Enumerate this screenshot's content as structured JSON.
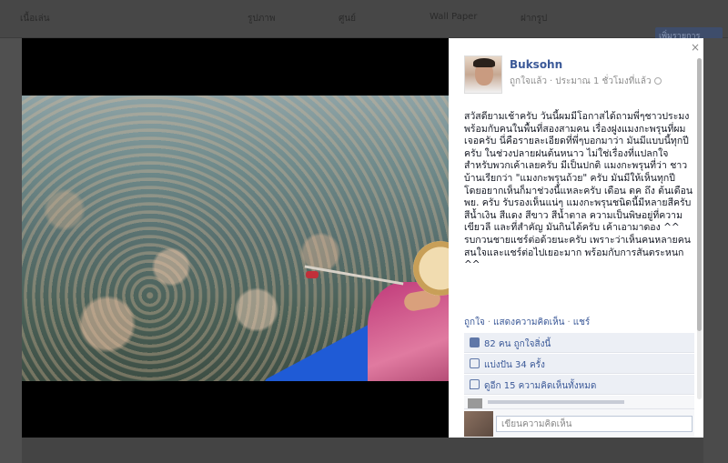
{
  "background": {
    "nav_items": [
      "เนื้อเล่น",
      "รูปภาพ",
      "ศูนย์",
      "Wall Paper",
      "ฝากรูป"
    ],
    "side_button": "เพิ่มรายการ"
  },
  "viewer": {
    "close_symbol": "×"
  },
  "post": {
    "author": "Buksohn",
    "meta_verb": "ถูกใจแล้ว",
    "meta_time": "ประมาณ 1 ชั่วโมงที่แล้ว",
    "text": "สวัสดียามเช้าครับ วันนี้ผมมีโอกาสได้ถามพี่ๆชาวประมง พร้อมกับคนในพื้นที่สองสามคน เรื่องฝูงแมงกะพรุนที่ผมเจอครับ นี่คือรายละเอียดที่พี่ๆบอกมาว่า มันมีแบบนี้ทุกปีครับ ในช่วงปลายฝนต้นหนาว ไม่ใช่เรื่องที่แปลกใจสำหรับพวกเค้าเลยครับ มีเป็นปกติ แมงกะพรุนที่ว่า ชาวบ้านเรียกว่า \"แมงกะพรุนถ้วย\" ครับ มันมีให้เห็นทุกปี โดยอยากเห็นก็มาช่วงนี้แหละครับ เดือน ตค ถึง ต้นเดือน พย. ครับ รับรองเห็นแน่ๆ แมงกะพรุนชนิดนี้มีหลายสีครับ สีน้ำเงิน สีแดง สีขาว สีน้ำตาล ความเป็นพิษอยู่ที่ความเขียวลี และที่สำคัญ มันกินได้ครับ เค้าเอามาดอง ^^ รบกวนชายแชร์ต่อด้วยนะครับ เพราะว่าเห็นคนหลายคนสนใจและแชร์ต่อไปเยอะมาก พร้อมกับการสันตระหนก ^^",
    "actions": [
      "ถูกใจ",
      "แสดงความคิดเห็น",
      "แชร์"
    ],
    "stats": {
      "likes": "82 คน ถูกใจสิ่งนี้",
      "shares": "แบ่งปัน 34 ครั้ง",
      "comments": "ดูอีก 15 ความคิดเห็นทั้งหมด"
    },
    "comment_placeholder": "เขียนความคิดเห็น"
  },
  "icons": {
    "close": "close-icon",
    "globe": "globe-icon",
    "like": "like-icon",
    "share": "share-icon",
    "comment": "comment-icon"
  }
}
